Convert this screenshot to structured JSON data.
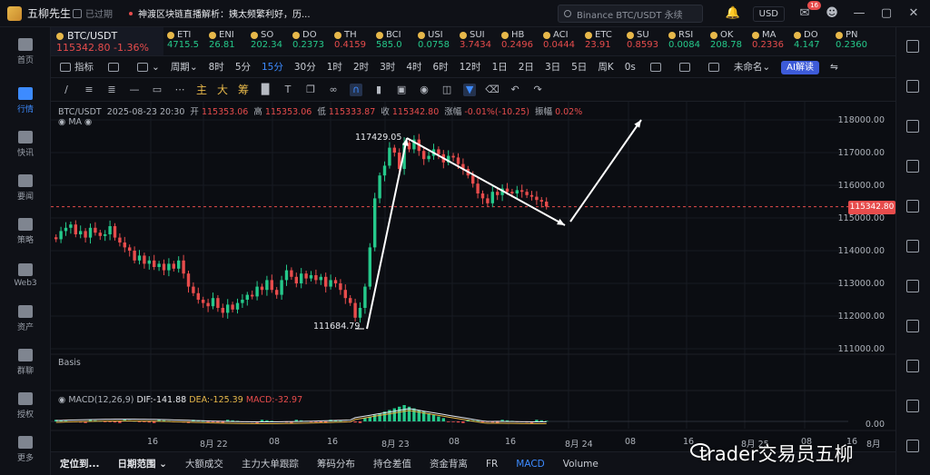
{
  "app": {
    "name": "五柳先生",
    "status": "已过期"
  },
  "news": {
    "text": "神渡区块链直播解析：姨太频繁利好，历..."
  },
  "search": {
    "placeholder": "Binance BTC/USDT 永续"
  },
  "currency": "USD",
  "mail_badge": "16",
  "sidebar": {
    "items": [
      {
        "label": "首页",
        "icon": "home-icon"
      },
      {
        "label": "行情",
        "icon": "market-chart-icon"
      },
      {
        "label": "快讯",
        "icon": "news-flash-icon"
      },
      {
        "label": "要闻",
        "icon": "headline-icon"
      },
      {
        "label": "策略",
        "icon": "strategy-icon"
      },
      {
        "label": "Web3",
        "icon": "web3-icon"
      },
      {
        "label": "资产",
        "icon": "assets-icon"
      },
      {
        "label": "群聊",
        "icon": "group-chat-icon"
      },
      {
        "label": "授权",
        "icon": "authorize-icon"
      },
      {
        "label": "更多",
        "icon": "more-icon"
      }
    ]
  },
  "quote_main": {
    "symbol": "BTC/USDT",
    "price": "115342.80",
    "change": "-1.36%"
  },
  "quotes": [
    {
      "symbol": "ETI",
      "price": "4715.5",
      "color": "green"
    },
    {
      "symbol": "ENI",
      "price": "26.81",
      "color": "green"
    },
    {
      "symbol": "SO",
      "price": "202.34",
      "color": "green"
    },
    {
      "symbol": "DO",
      "price": "0.2373",
      "color": "green"
    },
    {
      "symbol": "TH",
      "price": "0.4159",
      "color": "red"
    },
    {
      "symbol": "BCI",
      "price": "585.0",
      "color": "green"
    },
    {
      "symbol": "USI",
      "price": "0.0758",
      "color": "green"
    },
    {
      "symbol": "SUI",
      "price": "3.7434",
      "color": "red"
    },
    {
      "symbol": "HB",
      "price": "0.2496",
      "color": "red"
    },
    {
      "symbol": "ACI",
      "price": "0.0444",
      "color": "red"
    },
    {
      "symbol": "ETC",
      "price": "23.91",
      "color": "red"
    },
    {
      "symbol": "SU",
      "price": "0.8593",
      "color": "red"
    },
    {
      "symbol": "RSI",
      "price": "0.0084",
      "color": "green"
    },
    {
      "symbol": "OK",
      "price": "208.78",
      "color": "green"
    },
    {
      "symbol": "MA",
      "price": "0.2336",
      "color": "red"
    },
    {
      "symbol": "DO",
      "price": "4.147",
      "color": "green"
    },
    {
      "symbol": "PN",
      "price": "0.2360",
      "color": "green"
    }
  ],
  "toolbar1": {
    "indicator": "指标",
    "period": "周期",
    "intervals": [
      "8时",
      "5分",
      "15分",
      "30分",
      "1时",
      "2时",
      "3时",
      "4时",
      "6时",
      "12时",
      "1日",
      "2日",
      "3日",
      "5日",
      "周K"
    ],
    "active_interval": "15分",
    "os_label": "0s",
    "layout_name": "未命名",
    "ai_label": "AI解读"
  },
  "toolbar2": {
    "tools_zh": [
      "主",
      "大",
      "筹"
    ]
  },
  "chart_info": {
    "symbol": "BTC/USDT",
    "datetime": "2025-08-23 20:30",
    "open_label": "开",
    "open": "115353.06",
    "high_label": "高",
    "high": "115353.06",
    "low_label": "低",
    "low": "115333.87",
    "close_label": "收",
    "close": "115342.80",
    "change_label": "涨幅",
    "change": "-0.01%(-10.25)",
    "amp_label": "振幅",
    "amp": "0.02%",
    "ma_label": "MA"
  },
  "annotations": {
    "high": "117429.05",
    "low": "111684.79"
  },
  "panes": {
    "basis": "Basis",
    "macd_label": "MACD(12,26,9)",
    "dif": "DIF:-141.88",
    "dea": "DEA:-125.39",
    "macd": "MACD:-32.97",
    "macd_zero": "0.00"
  },
  "yticks": [
    "118000.00",
    "117000.00",
    "116000.00",
    "115000.00",
    "114000.00",
    "113000.00",
    "112000.00",
    "111000.00"
  ],
  "price_tag": "115342.80",
  "xticks": [
    "16",
    "8月 22",
    "08",
    "16",
    "8月 23",
    "08",
    "16",
    "8月 24",
    "08",
    "16",
    "8月 25",
    "08",
    "16",
    "8月"
  ],
  "bottom": {
    "items": [
      "定位到...",
      "日期范围",
      "大额成交",
      "主力大单跟踪",
      "筹码分布",
      "持仓差值",
      "资金背离",
      "FR",
      "MACD",
      "Volume"
    ],
    "active": "MACD"
  },
  "watermark": "trader交易员五柳",
  "colors": {
    "up": "#25c98b",
    "down": "#e74c4c",
    "accent": "#3d8bff",
    "bg": "#0b0d12"
  },
  "chart_data": {
    "type": "candlestick",
    "price_axis": {
      "min": 111000,
      "max": 118000
    },
    "annotations": [
      {
        "label": "117429.05",
        "kind": "high"
      },
      {
        "label": "111684.79",
        "kind": "low"
      }
    ],
    "closes": [
      114350,
      114600,
      114700,
      114800,
      114500,
      114600,
      114400,
      114700,
      114550,
      114450,
      114500,
      114750,
      114400,
      114250,
      114100,
      114000,
      113700,
      113850,
      113600,
      113700,
      113500,
      113600,
      113400,
      113600,
      113450,
      113700,
      113300,
      112900,
      112700,
      112500,
      112400,
      112300,
      112550,
      112250,
      112100,
      112350,
      112200,
      112400,
      112500,
      112650,
      112600,
      112900,
      112800,
      113100,
      112800,
      112650,
      113100,
      113400,
      113200,
      113000,
      113300,
      113150,
      113250,
      113100,
      113200,
      112900,
      113100,
      113000,
      112800,
      112550,
      112400,
      111950,
      112250,
      112900,
      114100,
      115600,
      116300,
      116600,
      117150,
      117000,
      116500,
      117300,
      117100,
      117400,
      117050,
      116800,
      116900,
      117100,
      116950,
      116700,
      116900,
      116850,
      116650,
      116500,
      116300,
      116050,
      115750,
      115600,
      115450,
      115800,
      115700,
      115900,
      115800,
      115750,
      115850,
      115800,
      115700,
      115650,
      115550,
      115500,
      115350
    ]
  }
}
